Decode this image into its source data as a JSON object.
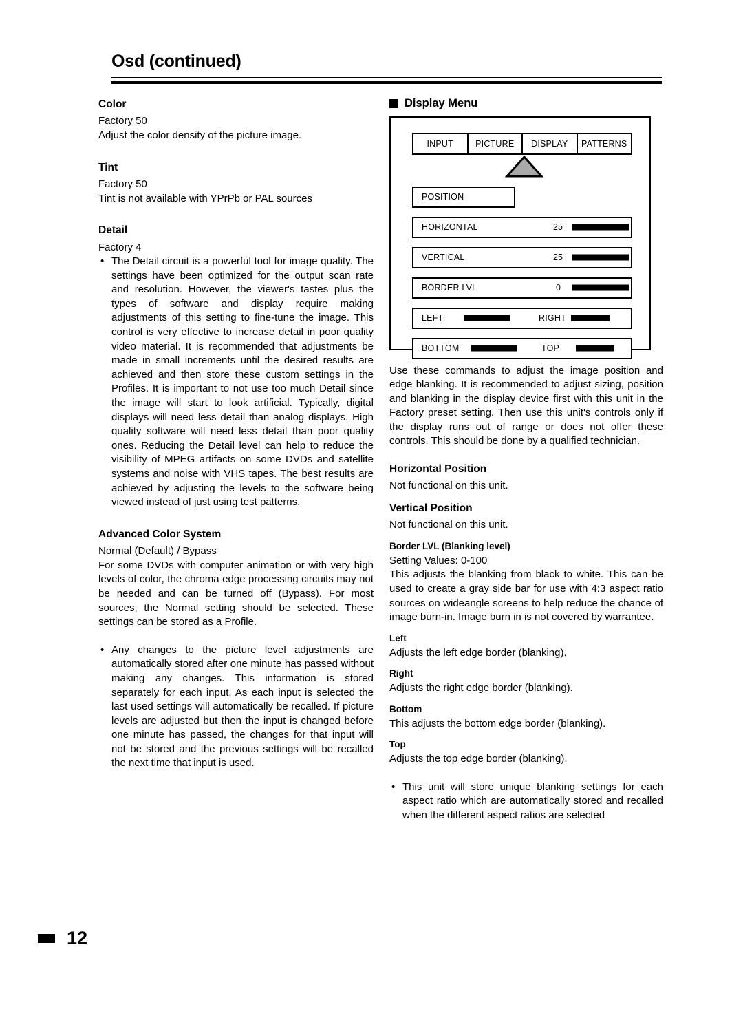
{
  "page": {
    "title": "Osd (continued)",
    "number": "12"
  },
  "left_column": {
    "sections": [
      {
        "heading": "Color",
        "lines": [
          "Factory 50",
          "Adjust the color density of the picture image."
        ]
      },
      {
        "heading": "Tint",
        "lines": [
          "Factory 50",
          "Tint is not available with YPrPb or PAL sources"
        ]
      },
      {
        "heading": "Detail",
        "lines": [
          "Factory 4"
        ],
        "bullet": "The Detail circuit is a powerful tool for image quality. The settings have been optimized for the output scan rate and resolution. However, the viewer's tastes plus the types of software and display require making adjustments of this setting to fine-tune the image. This control is very effective to increase detail in poor quality video material. It is recommended that adjustments be made in small increments until the desired results are achieved and then store these custom settings in the Profiles. It is important to not use too much Detail since the image will start to look artificial. Typically, digital displays will need less detail than analog displays. High quality software will need less detail than poor quality ones. Reducing the Detail level can help to reduce the visibility of MPEG artifacts on some DVDs and satellite systems and noise with VHS tapes. The best results are achieved by adjusting the levels to the software being viewed instead of just using test patterns."
      },
      {
        "heading": "Advanced Color System",
        "lines": [
          "Normal (Default) / Bypass"
        ],
        "paragraph": "For some DVDs with computer animation or with very high levels of color, the chroma edge processing circuits may not be needed and can be turned off (Bypass). For most sources, the Normal setting should be selected. These settings can be stored as a Profile.",
        "bullet": "Any changes to the picture level adjustments are automatically stored after one minute has passed without making any changes. This information is stored separately for each input. As each input is selected the last used settings will automatically be recalled. If picture levels are adjusted but then the input is changed before one minute has passed, the changes for that input will not be stored and the previous settings will be recalled the next time that input is used."
      }
    ],
    "bullet_glyph": "•"
  },
  "right_column": {
    "display_menu_heading": "Display Menu",
    "osd": {
      "tabs": [
        "INPUT",
        "PICTURE",
        "DISPLAY",
        "PATTERNS"
      ],
      "selected_tab": "DISPLAY",
      "pointer_icon": "triangle-up-icon",
      "menu_title": "POSITION",
      "rows": [
        {
          "label": "HORIZONTAL",
          "value": "25",
          "bar_pct": 100
        },
        {
          "label": "VERTICAL",
          "value": "25",
          "bar_pct": 100
        },
        {
          "label": "BORDER LVL",
          "value": "0",
          "bar_pct": 100
        }
      ],
      "pair_rows": [
        {
          "label_a": "LEFT",
          "label_b": "RIGHT"
        },
        {
          "label_a": "BOTTOM",
          "label_b": "TOP"
        }
      ]
    },
    "intro_paragraph": "Use these commands to adjust the image position and edge blanking. It is recommended to adjust sizing, position and blanking in the display device first with this unit in the Factory preset setting. Then use this unit's controls only if the display runs out of range or does not offer these controls. This should be done by a qualified technician.",
    "sections": [
      {
        "heading": "Horizontal Position",
        "size": "large",
        "lines": [
          "Not functional on this unit."
        ]
      },
      {
        "heading": "Vertical Position",
        "size": "large",
        "lines": [
          "Not functional on this unit."
        ]
      },
      {
        "heading": "Border LVL (Blanking level)",
        "size": "small",
        "lines": [
          "Setting Values: 0-100"
        ],
        "paragraph": "This adjusts the blanking from black to white. This can be used to create a gray side bar for use with 4:3 aspect ratio sources on wideangle screens to help reduce the chance of image burn-in. Image burn in is not covered by warrantee."
      },
      {
        "heading": "Left",
        "size": "small",
        "lines": [
          "Adjusts the left edge border (blanking)."
        ]
      },
      {
        "heading": "Right",
        "size": "small",
        "lines": [
          "Adjusts the right edge border (blanking)."
        ]
      },
      {
        "heading": "Bottom",
        "size": "small",
        "lines": [
          "This adjusts the bottom edge border (blanking)."
        ]
      },
      {
        "heading": "Top",
        "size": "small",
        "lines": [
          "Adjusts the top edge border (blanking)."
        ]
      }
    ],
    "final_bullet": "This unit will store unique blanking settings for each aspect ratio which are automatically stored and recalled when the different aspect ratios are selected"
  },
  "colors": {
    "ink": "#000000",
    "paper": "#ffffff",
    "arrow_fill": "#aaaaaa"
  }
}
